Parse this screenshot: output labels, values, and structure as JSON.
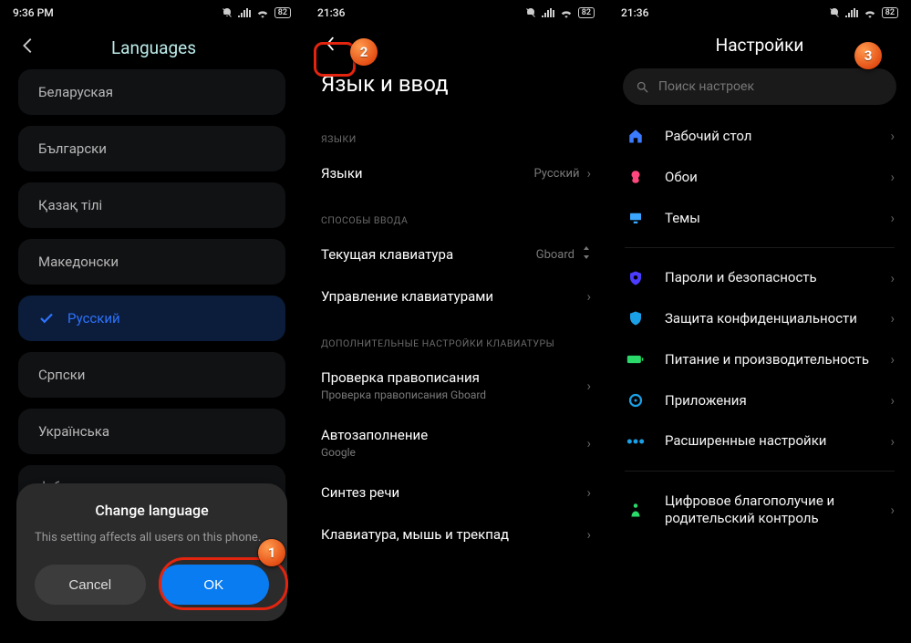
{
  "screen1": {
    "status_time": "9:36 PM",
    "battery": "82",
    "title": "Languages",
    "langs": [
      "Беларуская",
      "Български",
      "Қазақ тілі",
      "Македонски",
      "Русский",
      "Српски",
      "Українська",
      "ქართული"
    ],
    "selected_index": 4,
    "dialog": {
      "title": "Change language",
      "body": "This setting affects all users on this phone.",
      "cancel": "Cancel",
      "ok": "OK"
    },
    "annot": "1"
  },
  "screen2": {
    "status_time": "21:36",
    "battery": "82",
    "title": "Язык и ввод",
    "sec_langs": "ЯЗЫКИ",
    "row_langs": "Языки",
    "row_langs_val": "Русский",
    "sec_input": "СПОСОБЫ ВВОДА",
    "row_kbd": "Текущая клавиатура",
    "row_kbd_val": "Gboard",
    "row_kbd_mgmt": "Управление клавиатурами",
    "sec_extra": "ДОПОЛНИТЕЛЬНЫЕ НАСТРОЙКИ КЛАВИАТУРЫ",
    "row_spell": "Проверка правописания",
    "row_spell_sub": "Проверка правописания Gboard",
    "row_auto": "Автозаполнение",
    "row_auto_sub": "Google",
    "row_tts": "Синтез речи",
    "row_kmt": "Клавиатура, мышь и трекпад",
    "annot": "2"
  },
  "screen3": {
    "status_time": "21:36",
    "battery": "82",
    "title": "Настройки",
    "search_placeholder": "Поиск настроек",
    "items": [
      {
        "icon": "home",
        "color": "#3a7bff",
        "label": "Рабочий стол"
      },
      {
        "icon": "wallpaper",
        "color": "#ff477e",
        "label": "Обои"
      },
      {
        "icon": "theme",
        "color": "#3aa6ff",
        "label": "Темы"
      }
    ],
    "items2": [
      {
        "icon": "shield",
        "color": "#4b3cff",
        "label": "Пароли и безопасность"
      },
      {
        "icon": "privacy",
        "color": "#1aa0e6",
        "label": "Защита конфиденциальности"
      },
      {
        "icon": "battery",
        "color": "#2bd96b",
        "label": "Питание и производительность"
      },
      {
        "icon": "apps",
        "color": "#1aa0e6",
        "label": "Приложения"
      },
      {
        "icon": "more",
        "color": "#1aa0e6",
        "label": "Расширенные настройки"
      }
    ],
    "items3": [
      {
        "icon": "wellbeing",
        "color": "#2bd96b",
        "label": "Цифровое благополучие и родительский контроль"
      }
    ],
    "annot": "3"
  }
}
